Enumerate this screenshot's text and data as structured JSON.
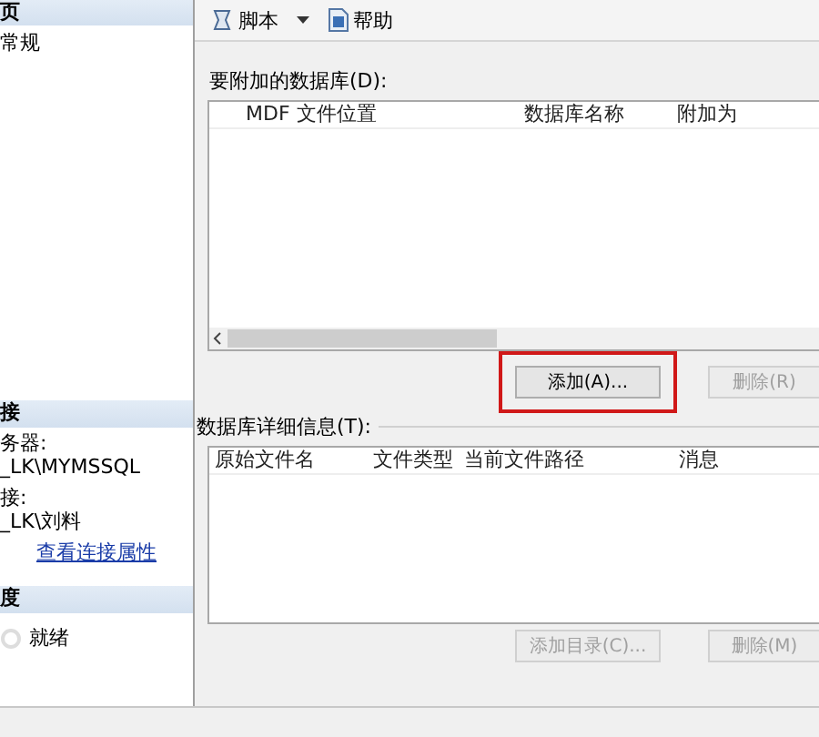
{
  "sidebar": {
    "title": "页",
    "items": [
      {
        "label": "常规",
        "selected": false
      }
    ],
    "connection": {
      "header": "接",
      "server_label": "务器:",
      "server": "_LK\\MYMSSQL",
      "connection_label": "接:",
      "connection": "_LK\\刘料",
      "link": "查看连接属性"
    },
    "progress": {
      "header": "度",
      "status": "就绪"
    }
  },
  "toolbar": [
    {
      "label": "脚本",
      "kind": "script"
    },
    {
      "label": "帮助",
      "kind": "help"
    }
  ],
  "databases": {
    "label": "要附加的数据库(D):",
    "columns": [
      "MDF 文件位置",
      "数据库名称",
      "附加为"
    ]
  },
  "buttons_top": [
    {
      "label": "添加(A)...",
      "disabled": false,
      "highlighted": true
    },
    {
      "label": "删除(R)",
      "disabled": true,
      "highlighted": false
    }
  ],
  "details": {
    "label": "数据库详细信息(T):",
    "columns": [
      "原始文件名",
      "文件类型",
      "当前文件路径",
      "消息"
    ]
  },
  "buttons_bottom": [
    {
      "label": "添加目录(C)...",
      "disabled": true,
      "highlighted": false
    },
    {
      "label": "删除(M)",
      "disabled": true,
      "highlighted": false
    }
  ]
}
